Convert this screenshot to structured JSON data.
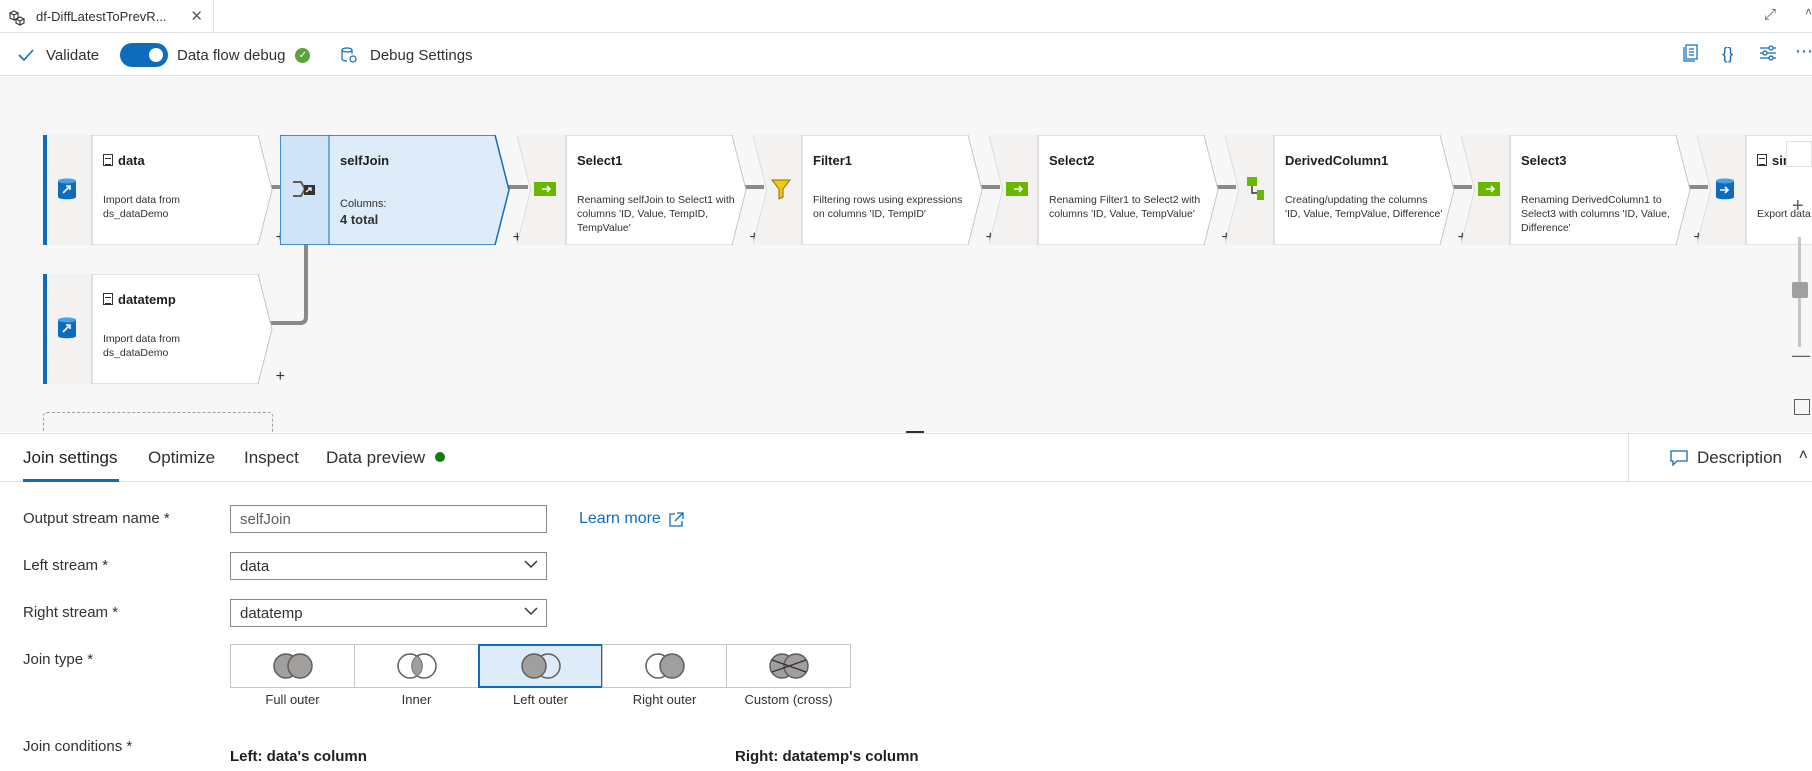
{
  "tab": {
    "title": "df-DiffLatestToPrevR...",
    "close": "✕"
  },
  "toolbar": {
    "validate": "Validate",
    "debug": "Data flow debug",
    "debug_settings": "Debug Settings"
  },
  "nodes": [
    {
      "title": "data",
      "desc": "Import data from ds_dataDemo"
    },
    {
      "title": "selfJoin",
      "columns_label": "Columns:",
      "columns_value": "4 total"
    },
    {
      "title": "Select1",
      "desc": "Renaming selfJoin to Select1 with columns 'ID, Value, TempID, TempValue'"
    },
    {
      "title": "Filter1",
      "desc": "Filtering rows using expressions on columns 'ID, TempID'"
    },
    {
      "title": "Select2",
      "desc": "Renaming Filter1 to Select2 with columns 'ID, Value, TempValue'"
    },
    {
      "title": "DerivedColumn1",
      "desc": "Creating/updating the columns 'ID, Value, TempValue, Difference'"
    },
    {
      "title": "Select3",
      "desc": "Renaming DerivedColumn1 to Select3 with columns 'ID, Value, Difference'"
    },
    {
      "title": "sink",
      "desc": "Export data"
    },
    {
      "title": "datatemp",
      "desc": "Import data from ds_dataDemo"
    }
  ],
  "panel": {
    "tabs": [
      "Join settings",
      "Optimize",
      "Inspect",
      "Data preview"
    ],
    "description": "Description"
  },
  "form": {
    "output_label": "Output stream name *",
    "output_value": "selfJoin",
    "learn_more": "Learn more",
    "left_label": "Left stream *",
    "left_value": "data",
    "right_label": "Right stream *",
    "right_value": "datatemp",
    "join_type_label": "Join type *",
    "join_types": [
      "Full outer",
      "Inner",
      "Left outer",
      "Right outer",
      "Custom (cross)"
    ],
    "selected_join_type": "Left outer",
    "join_conditions_label": "Join conditions *",
    "left_col_head": "Left: data's column",
    "right_col_head": "Right: datatemp's column"
  },
  "colors": {
    "accent": "#0f6cbd",
    "selected_node": "#deecf9",
    "success": "#59a33a"
  }
}
